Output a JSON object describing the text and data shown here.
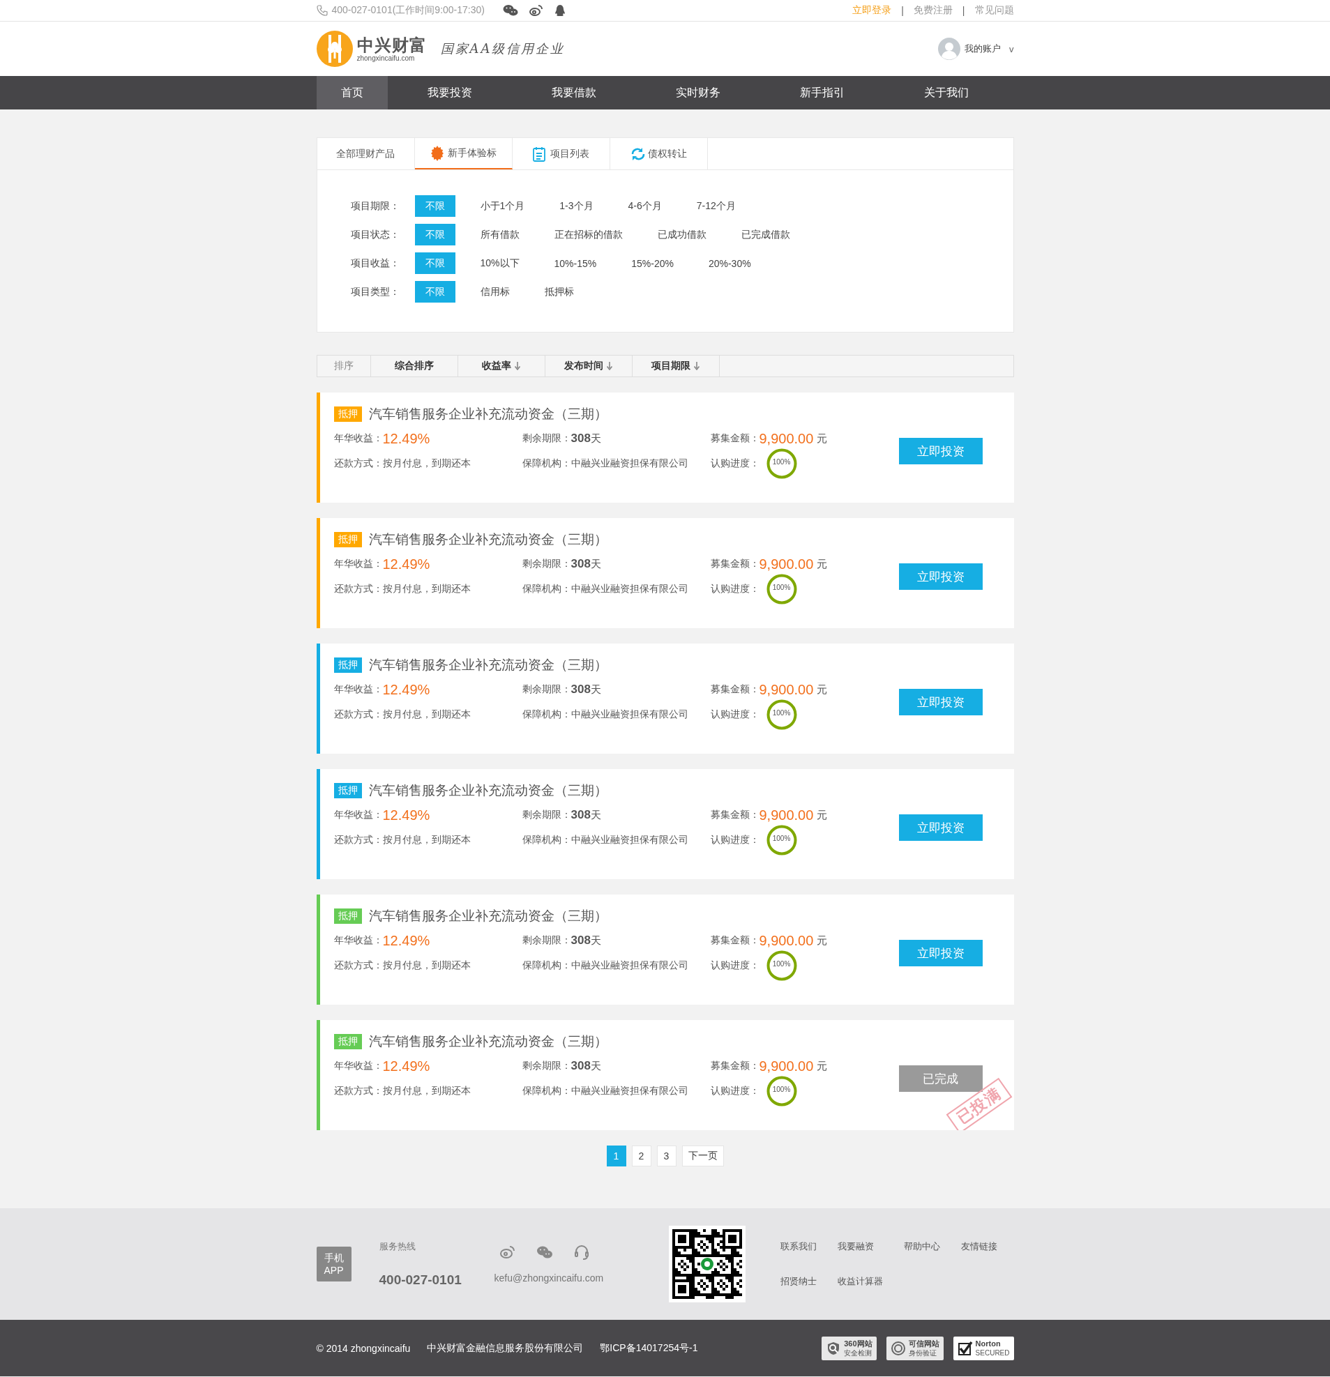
{
  "top_bar": {
    "phone": "400-027-0101(工作时间9:00-17:30)",
    "links": [
      {
        "label": "立即登录",
        "highlighted": true
      },
      {
        "label": "免费注册",
        "highlighted": false
      },
      {
        "label": "常见问题",
        "highlighted": false
      }
    ],
    "separator": "|"
  },
  "header": {
    "brand": "中兴财富",
    "domain": "zhongxincaifu.com",
    "slogan": "国家AA级信用企业",
    "account": "我的账户",
    "account_caret": "v"
  },
  "nav": [
    {
      "label": "首页",
      "selected": true
    },
    {
      "label": "我要投资",
      "selected": false
    },
    {
      "label": "我要借款",
      "selected": false
    },
    {
      "label": "实时财务",
      "selected": false
    },
    {
      "label": "新手指引",
      "selected": false
    },
    {
      "label": "关于我们",
      "selected": false
    }
  ],
  "tabs": [
    {
      "label": "全部理财产品",
      "selected": false
    },
    {
      "label": "新手体验标",
      "selected": true
    },
    {
      "label": "项目列表",
      "selected": false
    },
    {
      "label": "债权转让",
      "selected": false
    }
  ],
  "filters": [
    {
      "label": "项目期限：",
      "options": [
        {
          "label": "不限",
          "selected": true
        },
        {
          "label": "小于1个月",
          "selected": false
        },
        {
          "label": "1-3个月",
          "selected": false
        },
        {
          "label": "4-6个月",
          "selected": false
        },
        {
          "label": "7-12个月",
          "selected": false
        }
      ]
    },
    {
      "label": "项目状态：",
      "options": [
        {
          "label": "不限",
          "selected": true
        },
        {
          "label": "所有借款",
          "selected": false
        },
        {
          "label": "正在招标的借款",
          "selected": false
        },
        {
          "label": "已成功借款",
          "selected": false
        },
        {
          "label": "已完成借款",
          "selected": false
        }
      ]
    },
    {
      "label": "项目收益：",
      "options": [
        {
          "label": "不限",
          "selected": true
        },
        {
          "label": "10%以下",
          "selected": false
        },
        {
          "label": "10%-15%",
          "selected": false
        },
        {
          "label": "15%-20%",
          "selected": false
        },
        {
          "label": "20%-30%",
          "selected": false
        }
      ]
    },
    {
      "label": "项目类型：",
      "options": [
        {
          "label": "不限",
          "selected": true
        },
        {
          "label": "信用标",
          "selected": false
        },
        {
          "label": "抵押标",
          "selected": false
        }
      ]
    }
  ],
  "sort": {
    "label": "排序",
    "options": [
      {
        "label": "综合排序",
        "arrow": false
      },
      {
        "label": "收益率",
        "arrow": true
      },
      {
        "label": "发布时间",
        "arrow": true
      },
      {
        "label": "项目期限",
        "arrow": true
      }
    ]
  },
  "projects": [
    {
      "tag": "抵押",
      "color": "#ffa800",
      "title": "汽车销售服务企业补充流动资金（三期）",
      "rate_label": "年华收益：",
      "rate": "12.49%",
      "term_label": "剩余期限：",
      "term": "308",
      "term_unit": "天",
      "amount_label": "募集金额：",
      "amount": "9,900.00",
      "amount_unit": "元",
      "repay": "还款方式：按月付息，到期还本",
      "guarantor": "保障机构：中融兴业融资担保有限公司",
      "progress_label": "认购进度：",
      "progress": "100%",
      "button": "立即投资",
      "disabled": false
    },
    {
      "tag": "抵押",
      "color": "#ffa800",
      "title": "汽车销售服务企业补充流动资金（三期）",
      "rate_label": "年华收益：",
      "rate": "12.49%",
      "term_label": "剩余期限：",
      "term": "308",
      "term_unit": "天",
      "amount_label": "募集金额：",
      "amount": "9,900.00",
      "amount_unit": "元",
      "repay": "还款方式：按月付息，到期还本",
      "guarantor": "保障机构：中融兴业融资担保有限公司",
      "progress_label": "认购进度：",
      "progress": "100%",
      "button": "立即投资",
      "disabled": false
    },
    {
      "tag": "抵押",
      "color": "#16aee3",
      "title": "汽车销售服务企业补充流动资金（三期）",
      "rate_label": "年华收益：",
      "rate": "12.49%",
      "term_label": "剩余期限：",
      "term": "308",
      "term_unit": "天",
      "amount_label": "募集金额：",
      "amount": "9,900.00",
      "amount_unit": "元",
      "repay": "还款方式：按月付息，到期还本",
      "guarantor": "保障机构：中融兴业融资担保有限公司",
      "progress_label": "认购进度：",
      "progress": "100%",
      "button": "立即投资",
      "disabled": false
    },
    {
      "tag": "抵押",
      "color": "#16aee3",
      "title": "汽车销售服务企业补充流动资金（三期）",
      "rate_label": "年华收益：",
      "rate": "12.49%",
      "term_label": "剩余期限：",
      "term": "308",
      "term_unit": "天",
      "amount_label": "募集金额：",
      "amount": "9,900.00",
      "amount_unit": "元",
      "repay": "还款方式：按月付息，到期还本",
      "guarantor": "保障机构：中融兴业融资担保有限公司",
      "progress_label": "认购进度：",
      "progress": "100%",
      "button": "立即投资",
      "disabled": false
    },
    {
      "tag": "抵押",
      "color": "#66cc55",
      "title": "汽车销售服务企业补充流动资金（三期）",
      "rate_label": "年华收益：",
      "rate": "12.49%",
      "term_label": "剩余期限：",
      "term": "308",
      "term_unit": "天",
      "amount_label": "募集金额：",
      "amount": "9,900.00",
      "amount_unit": "元",
      "repay": "还款方式：按月付息，到期还本",
      "guarantor": "保障机构：中融兴业融资担保有限公司",
      "progress_label": "认购进度：",
      "progress": "100%",
      "button": "立即投资",
      "disabled": false
    },
    {
      "tag": "抵押",
      "color": "#66cc55",
      "title": "汽车销售服务企业补充流动资金（三期）",
      "rate_label": "年华收益：",
      "rate": "12.49%",
      "term_label": "剩余期限：",
      "term": "308",
      "term_unit": "天",
      "amount_label": "募集金额：",
      "amount": "9,900.00",
      "amount_unit": "元",
      "repay": "还款方式：按月付息，到期还本",
      "guarantor": "保障机构：中融兴业融资担保有限公司",
      "progress_label": "认购进度：",
      "progress": "100%",
      "button": "已完成",
      "disabled": true,
      "stamp": "已投满"
    }
  ],
  "pagination": {
    "pages": [
      {
        "label": "1",
        "selected": true
      },
      {
        "label": "2",
        "selected": false
      },
      {
        "label": "3",
        "selected": false
      }
    ],
    "next": "下一页"
  },
  "footer": {
    "app_badge": "手机 APP",
    "hotline_label": "服务热线",
    "hotline": "400-027-0101",
    "email": "kefu@zhongxincaifu.com",
    "links": [
      "联系我们",
      "我要融资",
      "帮助中心",
      "友情链接",
      "招贤纳士",
      "收益计算器"
    ]
  },
  "bottom_bar": {
    "copyright": "© 2014 zhongxincaifu",
    "company": "中兴财富金融信息服务股份有限公司",
    "icp": "鄂ICP备14017254号-1",
    "seals": [
      {
        "kind": "shield",
        "line1": "360网站",
        "line2": "安全检测"
      },
      {
        "kind": "ring",
        "line1": "可信网站",
        "line2": "身份验证"
      },
      {
        "kind": "check",
        "line1": "Norton",
        "line2": "SECURED"
      }
    ]
  }
}
